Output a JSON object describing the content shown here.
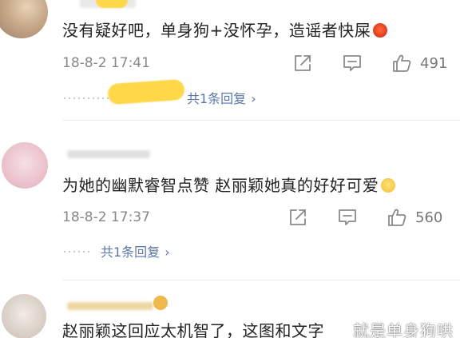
{
  "comments": [
    {
      "text": "没有疑好吧，单身狗+没怀孕，造谣者快屎",
      "emoji": "angry-emoji",
      "timestamp": "18-8-2 17:41",
      "like_count": "491",
      "reply_label": "共1条回复",
      "chevron": "›"
    },
    {
      "text": "为她的幽默睿智点赞 赵丽颖她真的好好可爱",
      "emoji": "shy-smile-emoji",
      "timestamp": "18-8-2 17:37",
      "like_count": "560",
      "reply_label": "共1条回复",
      "chevron": "›"
    },
    {
      "text": "赵丽颖这回应太机智了，这图和文字"
    }
  ],
  "watermark": "就是单身狗哄",
  "colors": {
    "text": "#222222",
    "meta": "#888888",
    "link": "#5a77b0",
    "highlight": "#ffd84a"
  },
  "icons": [
    "share-icon",
    "comment-icon",
    "like-icon"
  ]
}
